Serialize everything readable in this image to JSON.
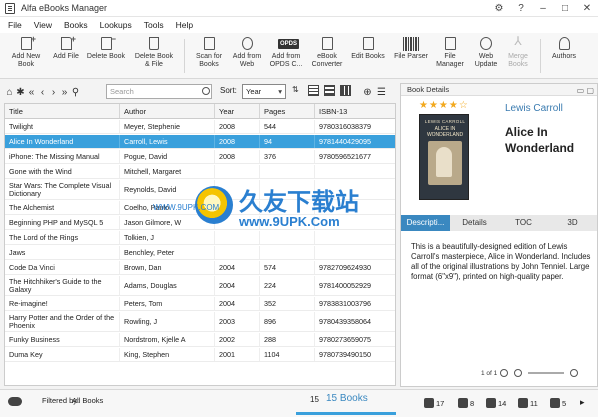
{
  "window": {
    "title": "Alfa eBooks Manager",
    "controls": [
      "⚙",
      "?",
      "–",
      "□",
      "✕"
    ]
  },
  "menu": [
    "File",
    "View",
    "Books",
    "Lookups",
    "Tools",
    "Help"
  ],
  "ribbon": [
    {
      "l1": "Add New",
      "l2": "Book",
      "icon": "book-plus-icon"
    },
    {
      "l1": "Add File",
      "l2": "",
      "icon": "file-plus-icon"
    },
    {
      "l1": "Delete Book",
      "l2": "",
      "icon": "book-minus-icon"
    },
    {
      "l1": "Delete Book",
      "l2": "& File",
      "icon": "trash-icon"
    },
    {
      "l1": "Scan for",
      "l2": "Books",
      "icon": "scan-icon"
    },
    {
      "l1": "Add from",
      "l2": "Web",
      "icon": "web-search-icon"
    },
    {
      "l1": "Add from",
      "l2": "OPDS C...",
      "icon": "opds-icon",
      "badge": "OPDS"
    },
    {
      "l1": "eBook",
      "l2": "Converter",
      "icon": "converter-icon"
    },
    {
      "l1": "Edit Books",
      "l2": "",
      "icon": "edit-books-icon"
    },
    {
      "l1": "File Parser",
      "l2": "",
      "icon": "barcode-icon"
    },
    {
      "l1": "File",
      "l2": "Manager",
      "icon": "file-manager-icon"
    },
    {
      "l1": "Web",
      "l2": "Update",
      "icon": "globe-icon"
    },
    {
      "l1": "Merge",
      "l2": "Books",
      "icon": "merge-icon"
    },
    {
      "l1": "Authors",
      "l2": "",
      "icon": "authors-icon"
    }
  ],
  "toolbar": {
    "search_placeholder": "Search",
    "sort_label": "Sort:",
    "sort_value": "Year"
  },
  "columns": [
    "Title",
    "Author",
    "Year",
    "Pages",
    "ISBN-13"
  ],
  "rows": [
    [
      "Twilight",
      "Meyer, Stephenie",
      "2008",
      "544",
      "9780316038379"
    ],
    [
      "Alice In Wonderland",
      "Carroll, Lewis",
      "2008",
      "94",
      "9781440429095"
    ],
    [
      "iPhone: The Missing Manual",
      "Pogue, David",
      "2008",
      "376",
      "9780596521677"
    ],
    [
      "Gone with the Wind",
      "Mitchell, Margaret",
      "",
      "",
      ""
    ],
    [
      "Star Wars: The Complete Visual Dictionary",
      "Reynolds, David",
      "",
      "",
      ""
    ],
    [
      "The Alchemist",
      "Coelho, Paulo",
      "",
      "",
      ""
    ],
    [
      "Beginning PHP and MySQL 5",
      "Jason Gilmore, W",
      "",
      "",
      ""
    ],
    [
      "The Lord of the Rings",
      "Tolkien, J",
      "",
      "",
      ""
    ],
    [
      "Jaws",
      "Benchley, Peter",
      "",
      "",
      ""
    ],
    [
      "Code Da Vinci",
      "Brown, Dan",
      "2004",
      "574",
      "9782709624930"
    ],
    [
      "The Hitchhiker's Guide to the Galaxy",
      "Adams, Douglas",
      "2004",
      "224",
      "9781400052929"
    ],
    [
      "Re-imagine!",
      "Peters, Tom",
      "2004",
      "352",
      "9783831003796"
    ],
    [
      "Harry Potter and the Order of the Phoenix",
      "Rowling, J",
      "2003",
      "896",
      "9780439358064"
    ],
    [
      "Funky Business",
      "Nordstrom, Kjelle A",
      "2002",
      "288",
      "9780273659075"
    ],
    [
      "Duma Key",
      "King, Stephen",
      "2001",
      "1104",
      "9780739490150"
    ]
  ],
  "selected_row": 1,
  "details": {
    "header": "Book Details",
    "author": "Lewis Carroll",
    "title": "Alice In Wonderland",
    "rating": "★★★★☆",
    "cover_author": "LEWIS CARROLL",
    "cover_title": "ALICE IN WONDERLAND",
    "tabs": [
      "Descripti...",
      "Details",
      "TOC",
      "3D"
    ],
    "description": "This is a beautifully-designed edition of Lewis Carroll's masterpiece, Alice in Wonderland. Includes all of the original illustrations by John Tenniel. Large format (6\"x9\"), printed on high-quality paper.",
    "pager": "1 of 1"
  },
  "status": {
    "filtered_label": "Filtered by:",
    "filtered_value": "All Books",
    "count_num": "15",
    "count_label": "15 Books",
    "stats": [
      "17",
      "8",
      "14",
      "11",
      "5"
    ]
  },
  "watermark": {
    "text": "久友下载站",
    "url": "www.9UPK.Com",
    "url2": "WWW.9UPK.COM"
  }
}
